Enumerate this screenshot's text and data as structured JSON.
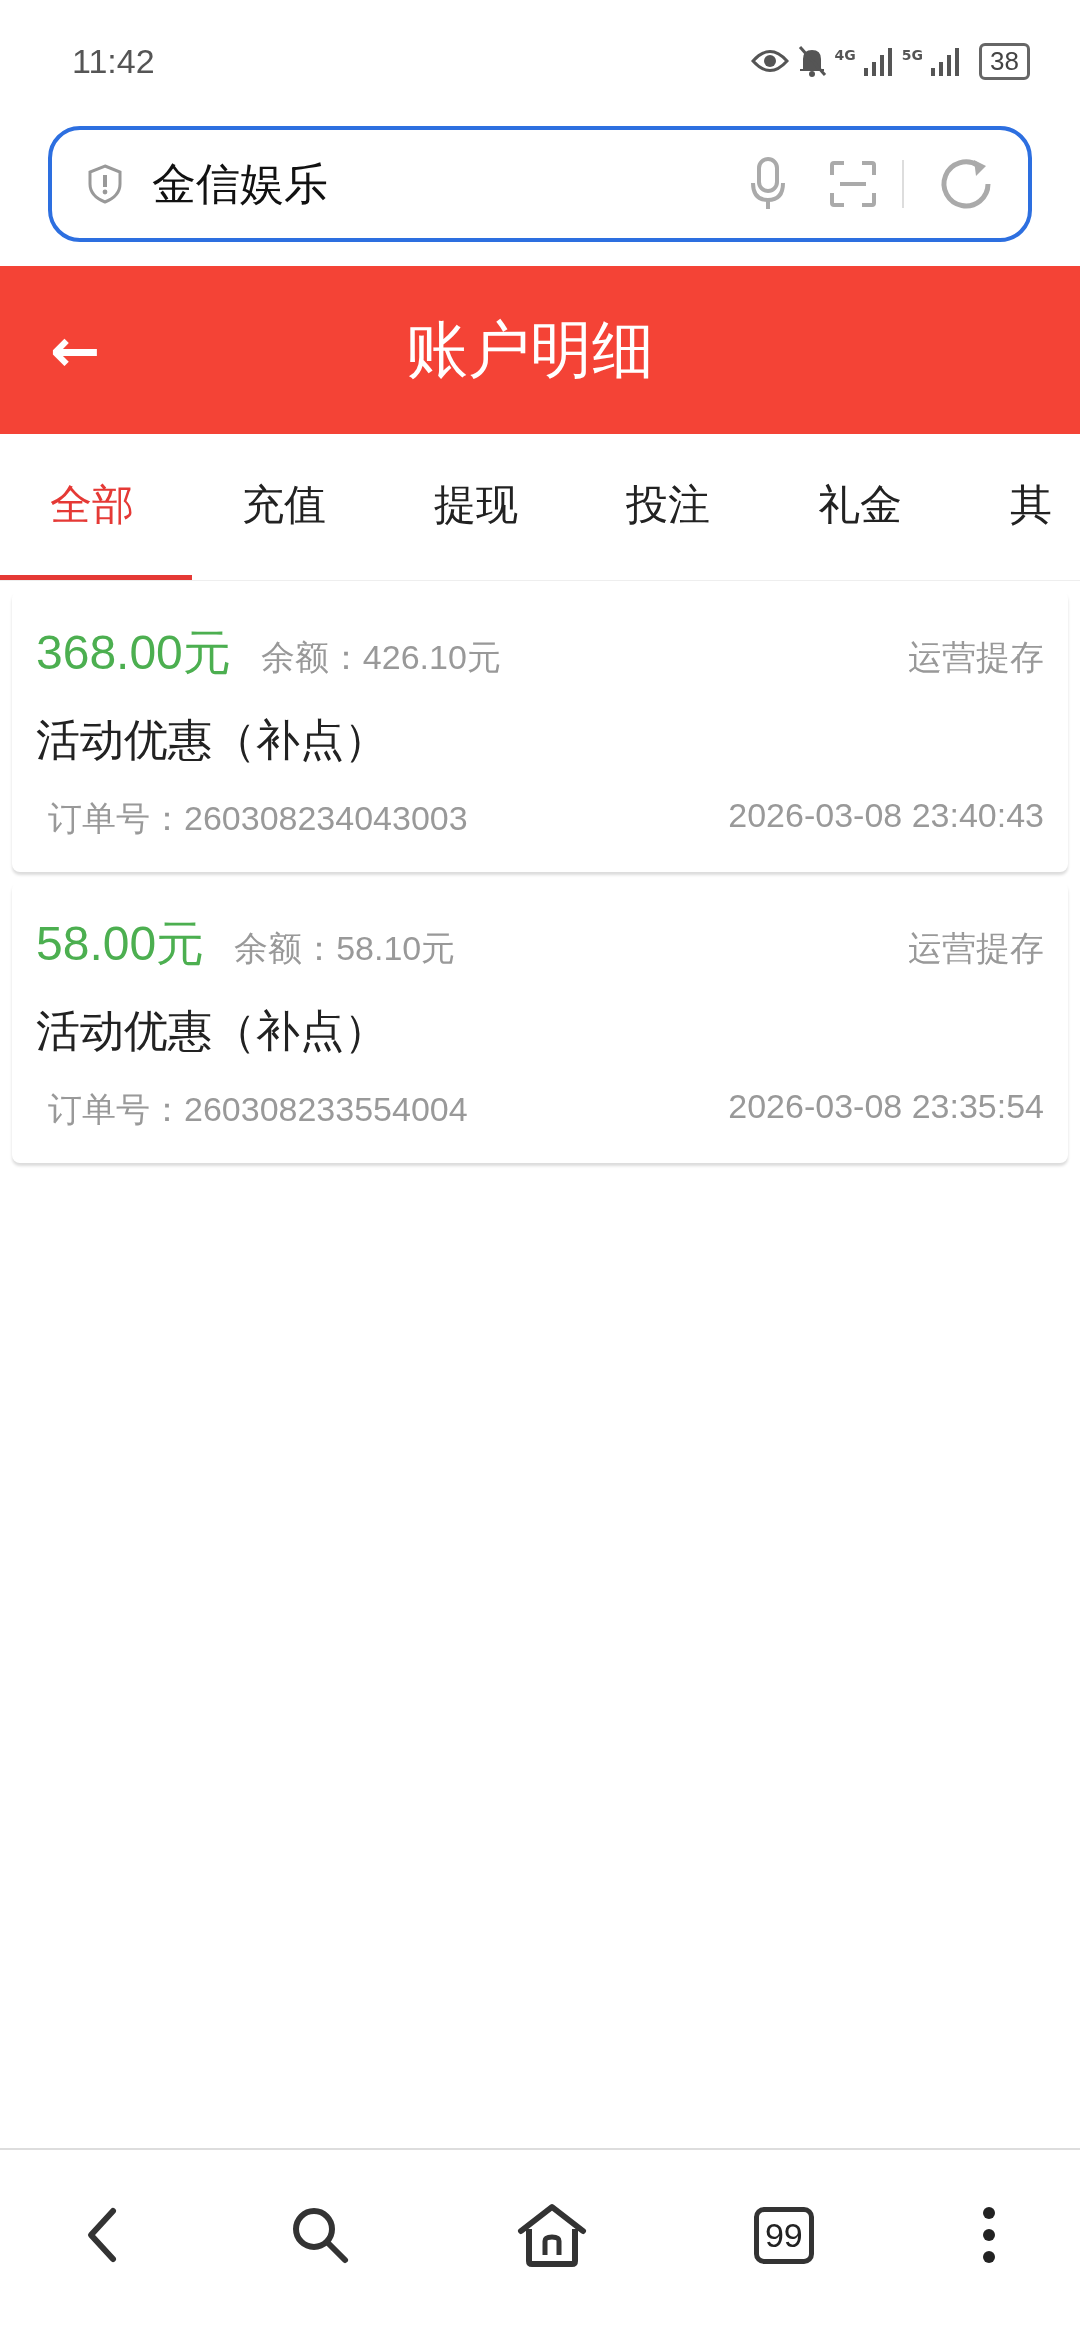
{
  "status_bar": {
    "time": "11:42",
    "network_1": "4G",
    "network_2": "5G",
    "battery": "38"
  },
  "search": {
    "value": "金信娱乐"
  },
  "header": {
    "back": "←",
    "title": "账户明细"
  },
  "tabs": [
    {
      "label": "全部",
      "selected": true
    },
    {
      "label": "充值",
      "selected": false
    },
    {
      "label": "提现",
      "selected": false
    },
    {
      "label": "投注",
      "selected": false
    },
    {
      "label": "礼金",
      "selected": false
    },
    {
      "label": "其",
      "selected": false
    }
  ],
  "records": [
    {
      "amount": "368.00元",
      "balance": "余额：426.10元",
      "type": "运营提存",
      "title": "活动优惠（补点）",
      "order": "订单号：260308234043003",
      "time": "2026-03-08 23:40:43"
    },
    {
      "amount": "58.00元",
      "balance": "余额：58.10元",
      "type": "运营提存",
      "title": "活动优惠（补点）",
      "order": "订单号：260308233554004",
      "time": "2026-03-08 23:35:54"
    }
  ],
  "bottom_nav": {
    "tabs_count": "99"
  }
}
